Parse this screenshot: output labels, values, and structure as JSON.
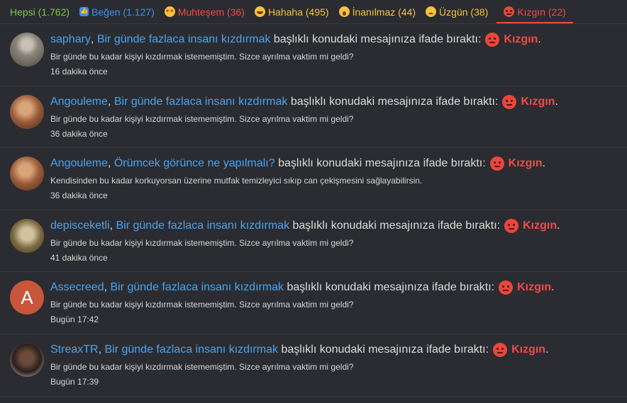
{
  "tabs": [
    {
      "label": "Hepsi (1.762)",
      "icon": "",
      "color": "#7ec64a"
    },
    {
      "label": "Beğen (1.127)",
      "icon": "like-icon",
      "color": "#3b8ff0"
    },
    {
      "label": "Muhteşem (36)",
      "icon": "love-eyes-icon",
      "color": "#f04a4a"
    },
    {
      "label": "Hahaha (495)",
      "icon": "laugh-icon",
      "color": "#f7c33a"
    },
    {
      "label": "İnanılmaz (44)",
      "icon": "wow-icon",
      "color": "#f7c33a"
    },
    {
      "label": "Üzgün (38)",
      "icon": "sad-icon",
      "color": "#f7c33a"
    },
    {
      "label": "Kızgın (22)",
      "icon": "angry-icon",
      "color": "#f04a4a"
    }
  ],
  "notifications": [
    {
      "user": "saphary",
      "topic": "Bir günde fazlaca insanı kızdırmak",
      "action": " başlıklı konudaki mesajınıza ifade bıraktı:",
      "reaction": "Kızgın",
      "snippet": "Bir günde bu kadar kişiyi kızdırmak istememiştim. Sizce ayrılma vaktim mi geldi?",
      "time": "16 dakika önce"
    },
    {
      "user": "Angouleme",
      "topic": "Bir günde fazlaca insanı kızdırmak",
      "action": " başlıklı konudaki mesajınıza ifade bıraktı:",
      "reaction": "Kızgın",
      "snippet": "Bir günde bu kadar kişiyi kızdırmak istememiştim. Sizce ayrılma vaktim mi geldi?",
      "time": "36 dakika önce"
    },
    {
      "user": "Angouleme",
      "topic": "Örümcek görünce ne yapılmalı?",
      "action": " başlıklı konudaki mesajınıza ifade bıraktı:",
      "reaction": "Kızgın",
      "snippet": "Kendisinden bu kadar korkuyorsan üzerine mutfak temizleyici sıkıp can çekişmesini sağlayabilirsin.",
      "time": "36 dakika önce"
    },
    {
      "user": "depisceketli",
      "topic": "Bir günde fazlaca insanı kızdırmak",
      "action": " başlıklı konudaki mesajınıza ifade bıraktı:",
      "reaction": "Kızgın",
      "snippet": "Bir günde bu kadar kişiyi kızdırmak istememiştim. Sizce ayrılma vaktim mi geldi?",
      "time": "41 dakika önce"
    },
    {
      "user": "Assecreed",
      "avatar_letter": "A",
      "topic": "Bir günde fazlaca insanı kızdırmak",
      "action": " başlıklı konudaki mesajınıza ifade bıraktı:",
      "reaction": "Kızgın",
      "snippet": "Bir günde bu kadar kişiyi kızdırmak istememiştim. Sizce ayrılma vaktim mi geldi?",
      "time": "Bugün 17:42"
    },
    {
      "user": "StreaxTR",
      "topic": "Bir günde fazlaca insanı kızdırmak",
      "action": " başlıklı konudaki mesajınıza ifade bıraktı:",
      "reaction": "Kızgın",
      "snippet": "Bir günde bu kadar kişiyi kızdırmak istememiştim. Sizce ayrılma vaktim mi geldi?",
      "time": "Bugün 17:39"
    }
  ]
}
